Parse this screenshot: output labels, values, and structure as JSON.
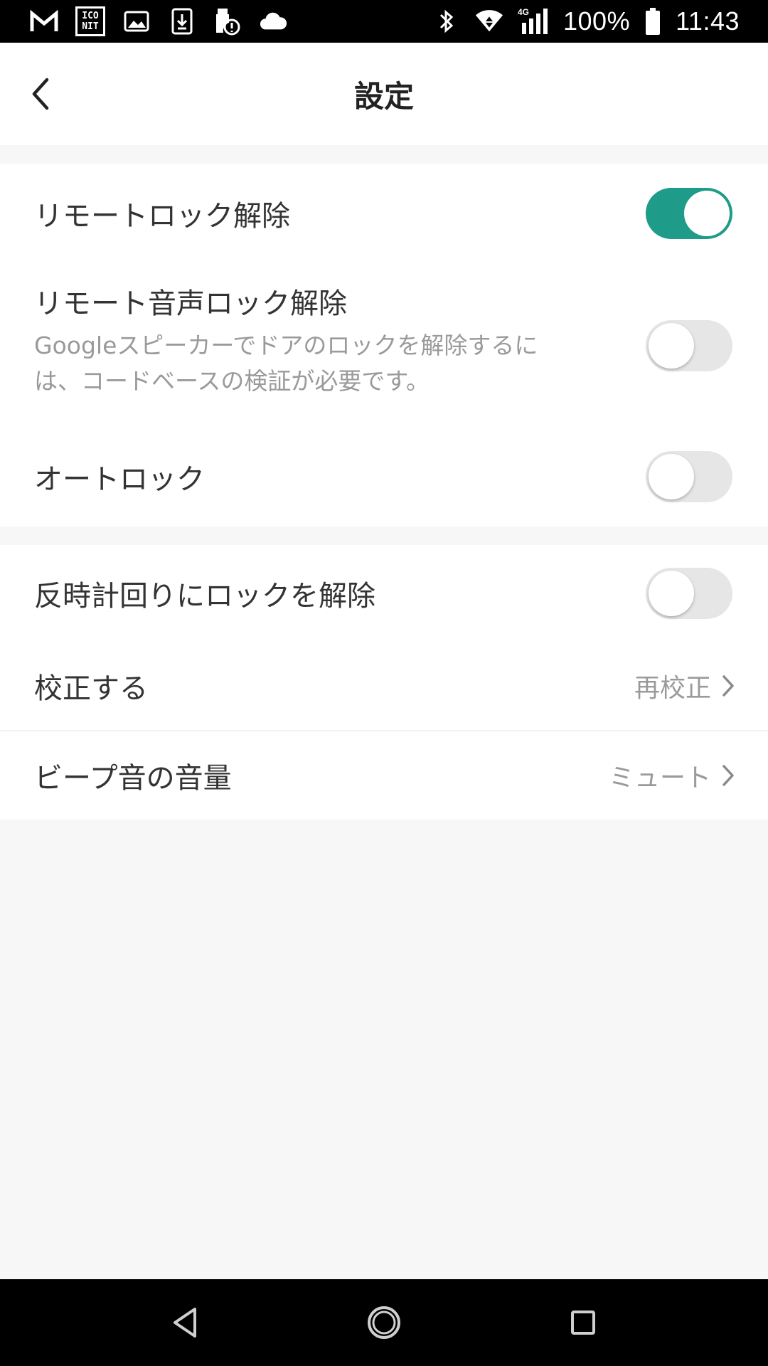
{
  "status_bar": {
    "left_icons": [
      "gmail-icon",
      "iconit-icon",
      "image-icon",
      "download-icon",
      "alert-icon",
      "cloud-icon"
    ],
    "iconit_text_top": "ICO",
    "iconit_text_bottom": "NIT",
    "network": "4G",
    "battery": "100%",
    "time": "11:43"
  },
  "header": {
    "title": "設定"
  },
  "settings": {
    "remote_unlock": {
      "label": "リモートロック解除",
      "enabled": true
    },
    "remote_voice_unlock": {
      "label": "リモート音声ロック解除",
      "description_line1": "Googleスピーカーでドアのロックを解除するに",
      "description_line2": "は、コードベースの検証が必要です。",
      "enabled": false
    },
    "auto_lock": {
      "label": "オートロック",
      "enabled": false
    },
    "counterclockwise_unlock": {
      "label": "反時計回りにロックを解除",
      "enabled": false
    },
    "calibrate": {
      "label": "校正する",
      "value": "再校正"
    },
    "beep_volume": {
      "label": "ビープ音の音量",
      "value": "ミュート"
    }
  },
  "colors": {
    "accent": "#1f9b89",
    "background": "#f7f7f7",
    "toggle_off": "#e6e6e6"
  }
}
